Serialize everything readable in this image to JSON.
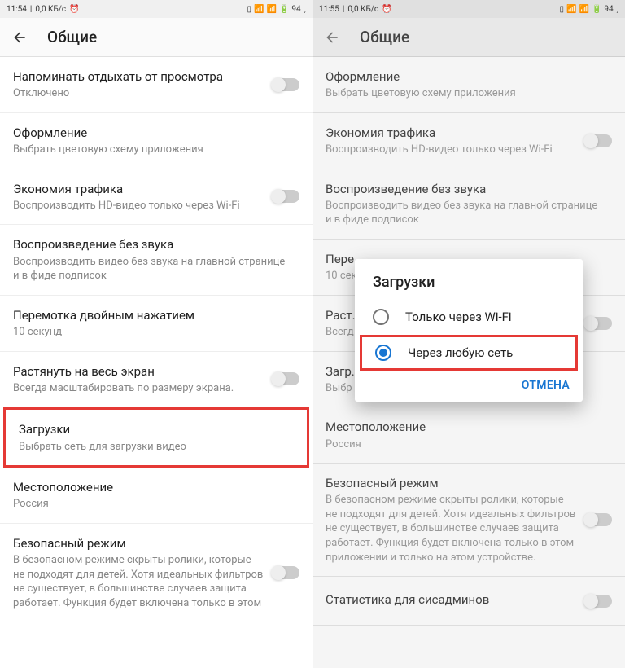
{
  "left": {
    "status": {
      "time": "11:54",
      "speed": "0,0 КБ/с",
      "battery": "94"
    },
    "header": {
      "title": "Общие"
    },
    "items": [
      {
        "title": "Напоминать отдыхать от просмотра",
        "subtitle": "Отключено",
        "toggle": true
      },
      {
        "title": "Оформление",
        "subtitle": "Выбрать цветовую схему приложения"
      },
      {
        "title": "Экономия трафика",
        "subtitle": "Воспроизводить HD-видео только через Wi-Fi",
        "toggle": true
      },
      {
        "title": "Воспроизведение без звука",
        "subtitle": "Воспроизводить видео без звука на главной странице и в фиде подписок"
      },
      {
        "title": "Перемотка двойным нажатием",
        "subtitle": "10 секунд"
      },
      {
        "title": "Растянуть на весь экран",
        "subtitle": "Всегда масштабировать по размеру экрана.",
        "toggle": true
      },
      {
        "title": "Загрузки",
        "subtitle": "Выбрать сеть для загрузки видео",
        "highlight": true
      },
      {
        "title": "Местоположение",
        "subtitle": "Россия"
      },
      {
        "title": "Безопасный режим",
        "subtitle": "В безопасном режиме скрыты ролики, которые не подходят для детей. Хотя идеальных фильтров не существует, в большинстве случаев защита работает. Функция будет включена только в этом",
        "toggle": true
      }
    ]
  },
  "right": {
    "status": {
      "time": "11:55",
      "speed": "0,0 КБ/с",
      "battery": "94"
    },
    "header": {
      "title": "Общие"
    },
    "items": [
      {
        "title": "Оформление",
        "subtitle": "Выбрать цветовую схему приложения"
      },
      {
        "title": "Экономия трафика",
        "subtitle": "Воспроизводить HD-видео только через Wi-Fi",
        "toggle": true
      },
      {
        "title": "Воспроизведение без звука",
        "subtitle": "Воспроизводить видео без звука на главной странице и в фиде подписок"
      },
      {
        "title": "Пере...",
        "subtitle": "10 сек"
      },
      {
        "title": "Раст...",
        "subtitle": "Всегд экран",
        "toggle": true
      },
      {
        "title": "Загр...",
        "subtitle": "Выбр"
      },
      {
        "title": "Местоположение",
        "subtitle": "Россия"
      },
      {
        "title": "Безопасный режим",
        "subtitle": "В безопасном режиме скрыты ролики, которые не подходят для детей. Хотя идеальных фильтров не существует, в большинстве случаев защита работает. Функция будет включена только в этом приложении и только на этом устройстве.",
        "toggle": true
      },
      {
        "title": "Статистика для сисадминов",
        "toggle": true
      }
    ],
    "dialog": {
      "title": "Загрузки",
      "options": [
        {
          "label": "Только через Wi-Fi",
          "selected": false
        },
        {
          "label": "Через любую сеть",
          "selected": true,
          "highlight": true
        }
      ],
      "cancel": "ОТМЕНА"
    }
  }
}
